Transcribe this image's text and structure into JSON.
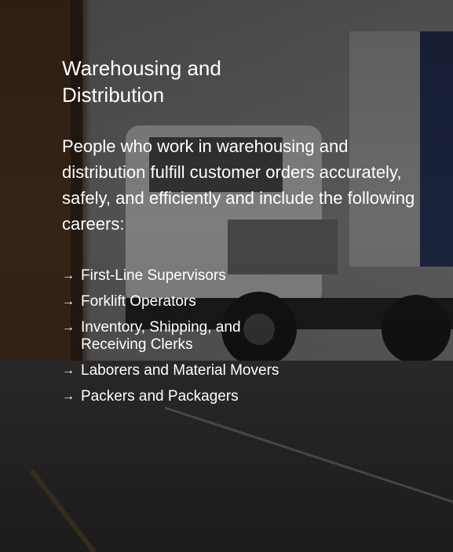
{
  "section": {
    "title": "Warehousing and Distribution",
    "intro": "People who work in warehousing and distribution fulfill customer orders accurately, safely, and efficiently and include the following careers:",
    "list_icon": "arrow-right-icon",
    "careers": [
      "First-Line Supervisors",
      "Forklift Operators",
      "Inventory, Shipping, and Receiving Clerks",
      "Laborers and Material Movers",
      "Packers and Packagers"
    ]
  },
  "colors": {
    "text": "#ffffff",
    "overlay": "#000000"
  }
}
